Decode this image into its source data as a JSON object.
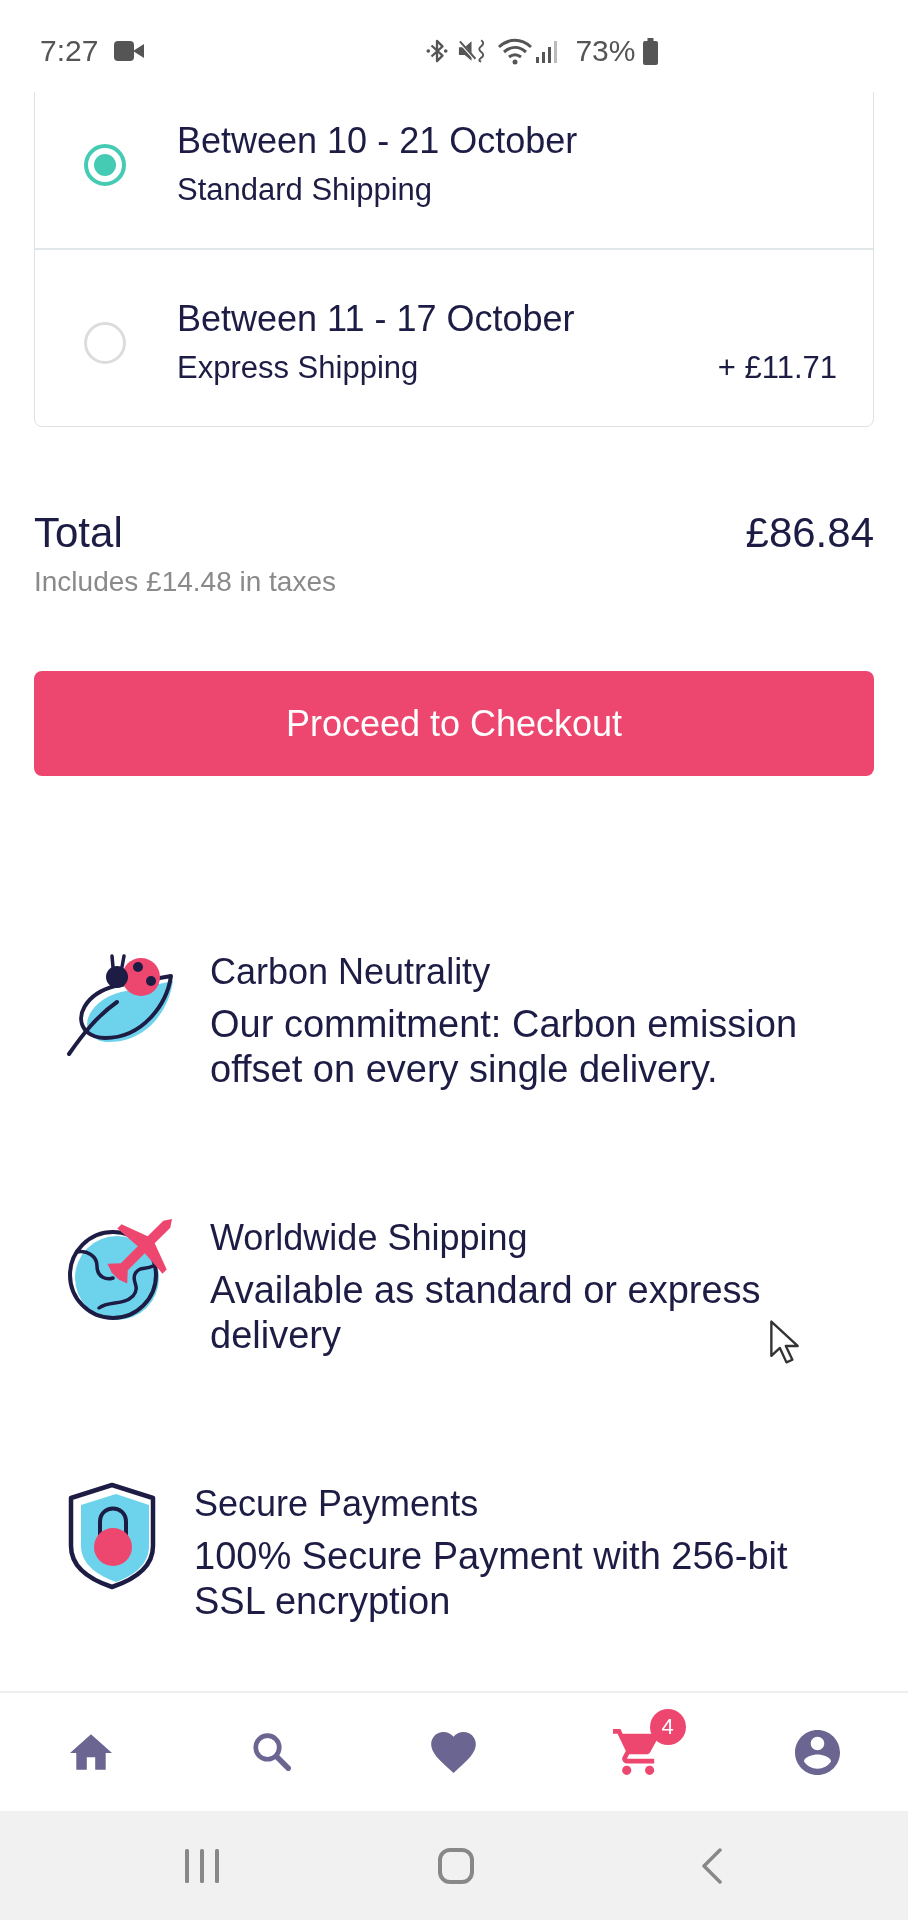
{
  "status_bar": {
    "time": "7:27",
    "battery": "73%"
  },
  "shipping_options": [
    {
      "title": "Between 10 - 21 October",
      "method": "Standard Shipping",
      "selected": true
    },
    {
      "title": "Between 11 - 17 October",
      "method": "Express Shipping",
      "price": "+ £11.71",
      "selected": false
    }
  ],
  "total": {
    "label": "Total",
    "amount": "£86.84",
    "tax_note": "Includes £14.48 in taxes"
  },
  "checkout_button": {
    "label": "Proceed to Checkout"
  },
  "features": [
    {
      "kind": "carbon",
      "title": "Carbon Neutrality",
      "description": "Our commitment: Carbon emission offset on every single delivery."
    },
    {
      "kind": "shipping",
      "title": "Worldwide Shipping",
      "description": "Available as standard or express delivery"
    },
    {
      "kind": "payment",
      "title": "Secure Payments",
      "description": "100% Secure Payment with 256-bit SSL encryption"
    }
  ],
  "bottom_nav": {
    "items": [
      {
        "kind": "home",
        "selected": false
      },
      {
        "kind": "search",
        "selected": false
      },
      {
        "kind": "favorites",
        "selected": false
      },
      {
        "kind": "cart",
        "selected": true,
        "badge": "4"
      },
      {
        "kind": "account",
        "selected": false
      }
    ]
  }
}
